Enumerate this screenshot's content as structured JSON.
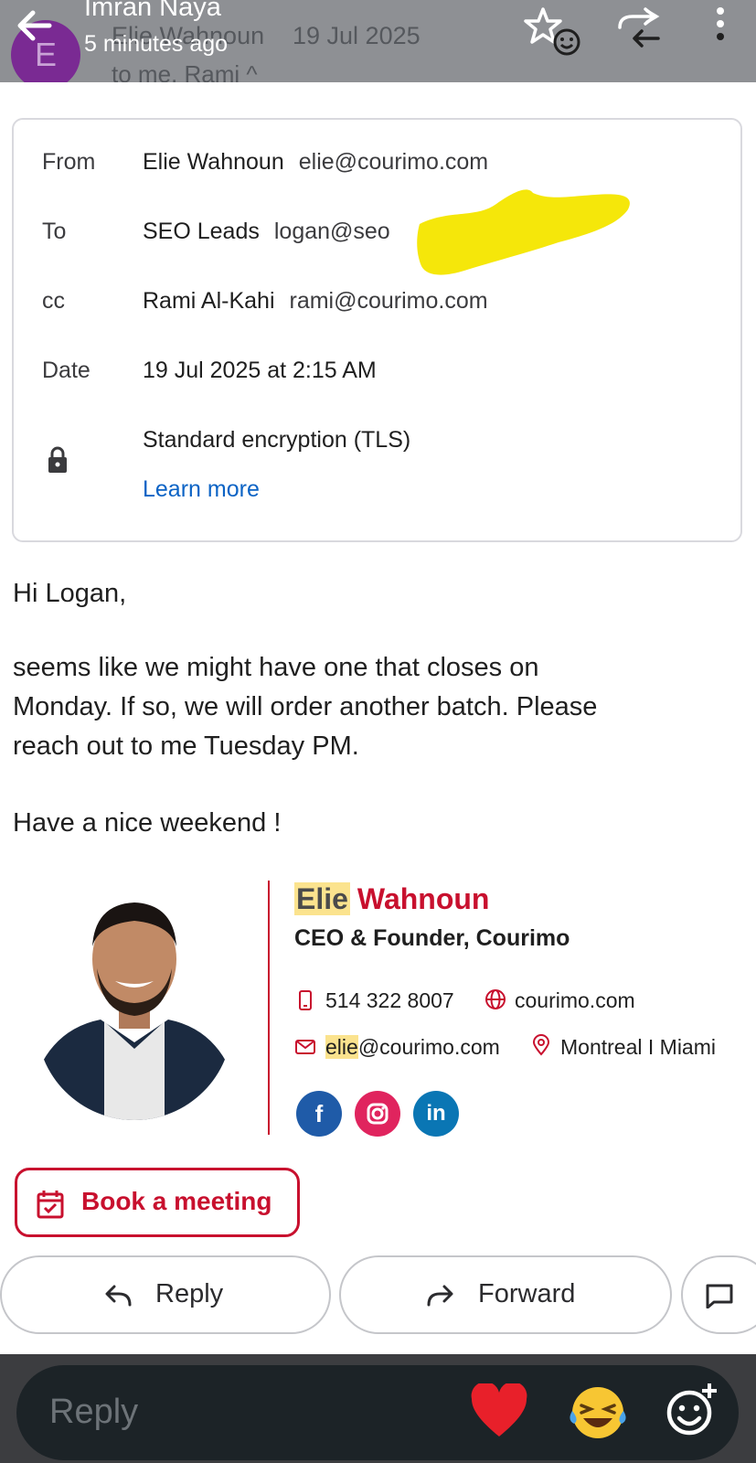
{
  "header": {
    "avatar_letter": "E",
    "bg_sender": "Elie Wahnoun",
    "bg_date": "19 Jul 2025",
    "bg_recipients": "to me, Rami ^",
    "notification_name": "Imran Naya",
    "notification_time": "5 minutes ago",
    "icons": [
      "back-arrow-icon",
      "star-icon",
      "smiley-icon",
      "reply-forward-icon",
      "more-vert-icon"
    ]
  },
  "details": {
    "from_label": "From",
    "from_name": "Elie Wahnoun",
    "from_email": "elie@courimo.com",
    "to_label": "To",
    "to_name": "SEO Leads",
    "to_email": "logan@seo",
    "cc_label": "cc",
    "cc_name": "Rami Al-Kahi",
    "cc_email": "rami@courimo.com",
    "date_label": "Date",
    "date_value": "19 Jul 2025 at 2:15 AM",
    "encryption": "Standard encryption (TLS)",
    "learn_more": "Learn more"
  },
  "message": {
    "greeting": "Hi Logan,",
    "line1": "seems like we might have one that closes on",
    "line2": "Monday. If so, we will order another batch. Please",
    "line3": "reach out to me Tuesday PM.",
    "closing": "Have a nice weekend !"
  },
  "signature": {
    "first_name": "Elie",
    "last_name": "Wahnoun",
    "title": "CEO & Founder, Courimo",
    "phone": "514 322 8007",
    "website": "courimo.com",
    "email_user": "elie",
    "email_domain": "@courimo.com",
    "location": "Montreal I Miami",
    "social": {
      "facebook": "f",
      "linkedin": "in"
    },
    "book_meeting": "Book a meeting",
    "accent_color": "#c8102e",
    "highlight_color": "#fbe38e"
  },
  "actions": {
    "reply": "Reply",
    "forward": "Forward"
  },
  "reply_bar": {
    "placeholder": "Reply"
  }
}
